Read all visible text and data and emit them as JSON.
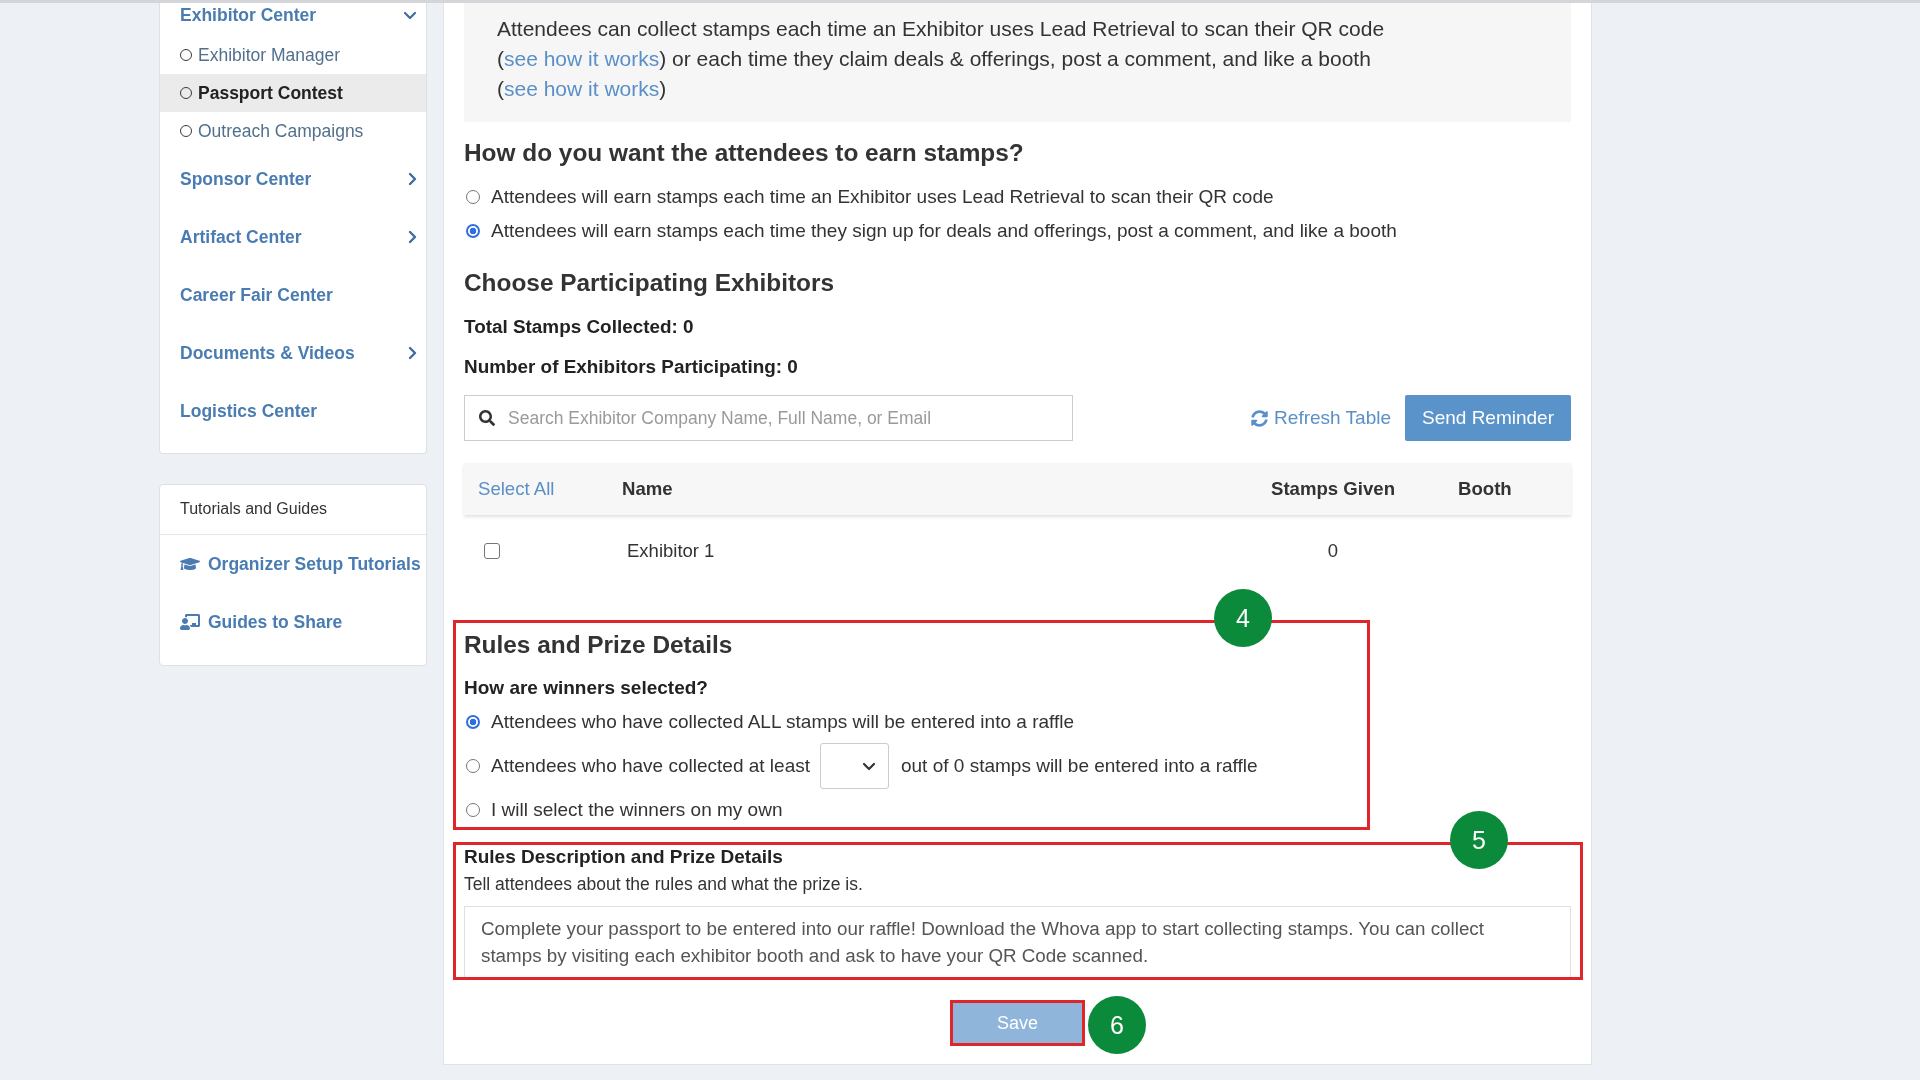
{
  "sidebar": {
    "nav_items": [
      {
        "label": "Exhibitor Center",
        "kind": "group",
        "expanded": true,
        "children": [
          {
            "label": "Exhibitor Manager",
            "selected": false
          },
          {
            "label": "Passport Contest",
            "selected": true
          },
          {
            "label": "Outreach Campaigns",
            "selected": false
          }
        ]
      },
      {
        "label": "Sponsor Center",
        "kind": "group",
        "expanded": false
      },
      {
        "label": "Artifact Center",
        "kind": "group",
        "expanded": false
      },
      {
        "label": "Career Fair Center",
        "kind": "link"
      },
      {
        "label": "Documents & Videos",
        "kind": "group",
        "expanded": false
      },
      {
        "label": "Logistics Center",
        "kind": "link"
      }
    ],
    "guides": {
      "title": "Tutorials and Guides",
      "links": [
        {
          "label": "Organizer Setup Tutorials",
          "kind": "tutorials"
        },
        {
          "label": "Guides to Share",
          "kind": "share"
        }
      ]
    }
  },
  "intro": {
    "parts": [
      {
        "kind": "text",
        "text": "Attendees can collect stamps each time an Exhibitor uses Lead Retrieval to scan their QR code ("
      },
      {
        "kind": "link",
        "text": "see how it works"
      },
      {
        "kind": "text",
        "text": ") or each time they claim deals & offerings, post a comment, and like a booth ("
      },
      {
        "kind": "link",
        "text": "see how it works"
      },
      {
        "kind": "text",
        "text": ")"
      }
    ]
  },
  "earn_stamps": {
    "title": "How do you want the attendees to earn stamps?",
    "options": [
      {
        "label": "Attendees will earn stamps each time an Exhibitor uses Lead Retrieval to scan their QR code",
        "selected": false
      },
      {
        "label": "Attendees will earn stamps each time they sign up for deals and offerings, post a comment, and like a booth",
        "selected": true
      }
    ]
  },
  "exhibitors": {
    "title": "Choose Participating Exhibitors",
    "stats": [
      "Total Stamps Collected: 0",
      "Number of Exhibitors Participating: 0"
    ],
    "search": {
      "placeholder": "Search Exhibitor Company Name, Full Name, or Email"
    },
    "refresh_button": "Refresh Table",
    "reminder_button": "Send Reminder",
    "table": {
      "columns": [
        {
          "label": "Select All",
          "kind": "action"
        },
        {
          "label": "Name",
          "kind": "heading"
        },
        {
          "label": "Stamps Given",
          "kind": "heading"
        },
        {
          "label": "Booth",
          "kind": "heading"
        }
      ],
      "rows": [
        {
          "checked": false,
          "name": "Exhibitor 1",
          "stamps_given": "0"
        }
      ]
    }
  },
  "rules": {
    "callout": "4",
    "title": "Rules and Prize Details",
    "question": "How are winners selected?",
    "options": [
      {
        "kind": "plain",
        "label": "Attendees who have collected ALL stamps will be entered into a raffle",
        "selected": true
      },
      {
        "kind": "threshold",
        "label": "Attendees who have collected at least",
        "label_after": "out of 0 stamps will be entered into a raffle",
        "selected": false
      },
      {
        "kind": "plain",
        "label": "I will select the winners on my own",
        "selected": false
      }
    ]
  },
  "description": {
    "callout": "5",
    "title": "Rules Description and Prize Details",
    "hint": "Tell attendees about the rules and what the prize is.",
    "value": "Complete your passport to be entered into our raffle! Download the Whova app to start collecting stamps. You can collect stamps by visiting each exhibitor booth and ask to have your QR Code scanned."
  },
  "save_button": {
    "label": "Save",
    "callout": "6"
  }
}
